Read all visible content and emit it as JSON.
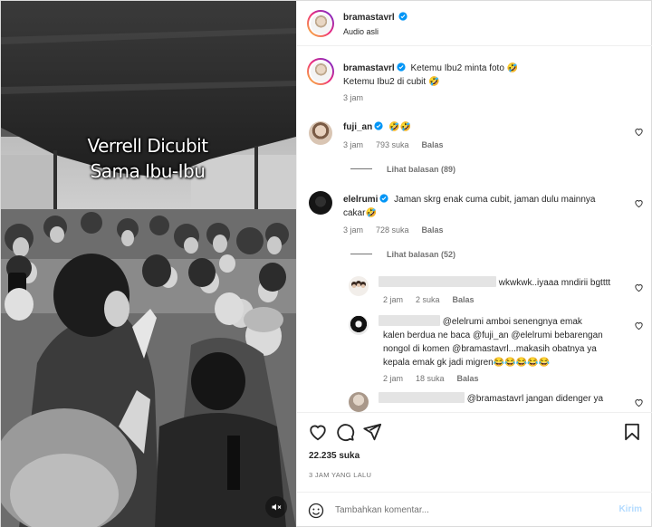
{
  "media": {
    "overlay_line1": "Verrell Dicubit",
    "overlay_line2": "Sama Ibu-Ibu",
    "volume_icon": "speaker-muted-icon"
  },
  "header": {
    "username": "bramastavrl",
    "subtitle": "Audio asli",
    "more_icon": "more-horizontal-icon"
  },
  "caption": {
    "username": "bramastavrl",
    "line1": "Ketemu Ibu2 minta foto 🤣",
    "line2": "Ketemu Ibu2 di cubit 🤣",
    "time": "3 jam"
  },
  "comments": [
    {
      "username": "fuji_an",
      "text": "🤣🤣",
      "time": "3 jam",
      "likes": "793 suka",
      "reply": "Balas",
      "view_replies": "Lihat balasan (89)"
    },
    {
      "username": "elelrumi",
      "text_line1": "Jaman skrg enak cuma cubit, jaman dulu mainnya",
      "text_line2": "cakar🤣",
      "time": "3 jam",
      "likes": "728 suka",
      "reply": "Balas",
      "view_replies": "Lihat balasan (52)"
    }
  ],
  "replies": [
    {
      "text": "wkwkwk..iyaaa mndirii bgtttt",
      "time": "2 jam",
      "likes": "2 suka",
      "reply": "Balas"
    },
    {
      "text_line1": "@elelrumi amboi senengnya emak",
      "text_line2": "kalen berdua ne baca @fuji_an @elelrumi bebarengan",
      "text_line3": "nongol di komen @bramastavrl...makasih obatnya ya",
      "text_line4": "kepala emak gk jadi migren😂😂😂😂😂",
      "time": "2 jam",
      "likes": "18 suka",
      "reply": "Balas"
    },
    {
      "text": "@bramastavrl jangan didenger ya"
    }
  ],
  "actions": {
    "like_icon": "heart-icon",
    "comment_icon": "comment-icon",
    "share_icon": "share-icon",
    "save_icon": "bookmark-icon",
    "likes": "22.235 suka",
    "time_ago": "3 JAM YANG LALU"
  },
  "comment_box": {
    "placeholder": "Tambahkan komentar...",
    "post_label": "Kirim",
    "emoji_icon": "emoji-icon"
  },
  "colors": {
    "text": "#262626",
    "secondary": "#737373",
    "verified": "#0095f6",
    "post_disabled": "#b3dbff"
  }
}
